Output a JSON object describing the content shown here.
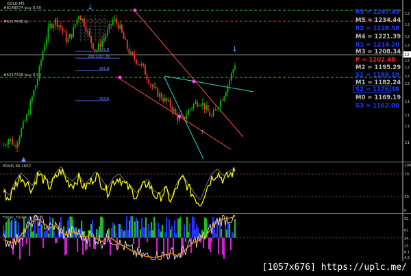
{
  "header": {
    "symbol_label": "GOLD,M5"
  },
  "order_labels": [
    "#6148574 buy 0.50",
    "#6217438 tp",
    "#6217438 buy 0.50"
  ],
  "fib_labels": [
    "161.8",
    "200 1207.79",
    "261.8",
    "423.6"
  ],
  "pivot_levels": [
    {
      "label": "R3 = 1247.45",
      "color": "#1a3cff",
      "boxed": false
    },
    {
      "label": "M5 = 1234.44",
      "color": "#bfbfbf",
      "boxed": false
    },
    {
      "label": "R2 = 1228.58",
      "color": "#1a3cff",
      "boxed": false
    },
    {
      "label": "M4 = 1221.39",
      "color": "#bfbfbf",
      "boxed": false
    },
    {
      "label": "R1 = 1214.20",
      "color": "#1a3cff",
      "boxed": false
    },
    {
      "label": "M3 = 1208.34",
      "color": "#bfbfbf",
      "boxed": false
    },
    {
      "label": "P = 1202.48",
      "color": "#ff2222",
      "boxed": false
    },
    {
      "label": "M2 = 1195.29",
      "color": "#bfbfbf",
      "boxed": false
    },
    {
      "label": "S1 = 1188.10",
      "color": "#1a3cff",
      "boxed": false
    },
    {
      "label": "M1 = 1182.24",
      "color": "#bfbfbf",
      "boxed": false
    },
    {
      "label": "S2 = 1176.38",
      "color": "#1a3cff",
      "boxed": true
    },
    {
      "label": "M0 = 1169.19",
      "color": "#bfbfbf",
      "boxed": false
    },
    {
      "label": "S3 = 1162.00",
      "color": "#1a3cff",
      "boxed": false
    }
  ],
  "right_axis_ticks": [
    "12",
    "12",
    "12",
    "12",
    "12",
    "12",
    "12",
    "12",
    "11",
    "11",
    "11",
    "11"
  ],
  "rsi_panel": {
    "label": "RSI(8) 66.1667",
    "ticks": [
      "100",
      "70",
      "30",
      "0"
    ]
  },
  "fisher_panel": {
    "label": "Fisher_Yur4ik 0.726",
    "ticks": [
      "92.",
      "61.",
      "34.",
      "23.",
      "8.1",
      "4.2"
    ]
  },
  "footer": {
    "text": "[1057x676] https://uplc.me/"
  },
  "colors": {
    "bull_candle": "#00c000",
    "bear_candle": "#ff3333",
    "rsi_line": "#ffff00",
    "fisher_line": "#ff8c00",
    "hist_blue": "#2233ff",
    "hist_green": "#22bb22",
    "hist_magenta": "#cc22cc"
  },
  "chart_data": {
    "type": "candlestick",
    "timeframe": "M5",
    "y_scale_labels": [
      "1247.45",
      "1234.44",
      "1228.58",
      "1221.39",
      "1214.20",
      "1208.34",
      "1202.48",
      "1195.29",
      "1188.10",
      "1182.24",
      "1176.38",
      "1169.19",
      "1162.00"
    ],
    "price_path": [
      1150,
      1155,
      1149,
      1160,
      1170,
      1185,
      1200,
      1222,
      1236,
      1240,
      1235,
      1225,
      1232,
      1245,
      1238,
      1226,
      1218,
      1225,
      1232,
      1241,
      1236,
      1224,
      1215,
      1211,
      1207,
      1198,
      1190,
      1186,
      1182,
      1178,
      1170,
      1168,
      1175,
      1180,
      1182,
      1176,
      1170,
      1178,
      1186,
      1196,
      1209
    ],
    "rsi_values": [
      40,
      25,
      55,
      72,
      60,
      45,
      78,
      65,
      50,
      70,
      85,
      62,
      55,
      70,
      48,
      60,
      75,
      58,
      40,
      62,
      70,
      55,
      45,
      30,
      50,
      60,
      35,
      28,
      45,
      20,
      52,
      68,
      48,
      30,
      15,
      45,
      70,
      80,
      65,
      75,
      82
    ],
    "fisher_values": [
      45,
      40,
      38,
      55,
      70,
      85,
      90,
      80,
      70,
      75,
      60,
      55,
      62,
      58,
      50,
      55,
      48,
      40,
      52,
      45,
      35,
      30,
      22,
      15,
      10,
      8,
      6,
      8,
      12,
      15,
      10,
      18,
      30,
      40,
      45,
      55,
      70,
      85,
      90,
      92,
      95
    ]
  }
}
